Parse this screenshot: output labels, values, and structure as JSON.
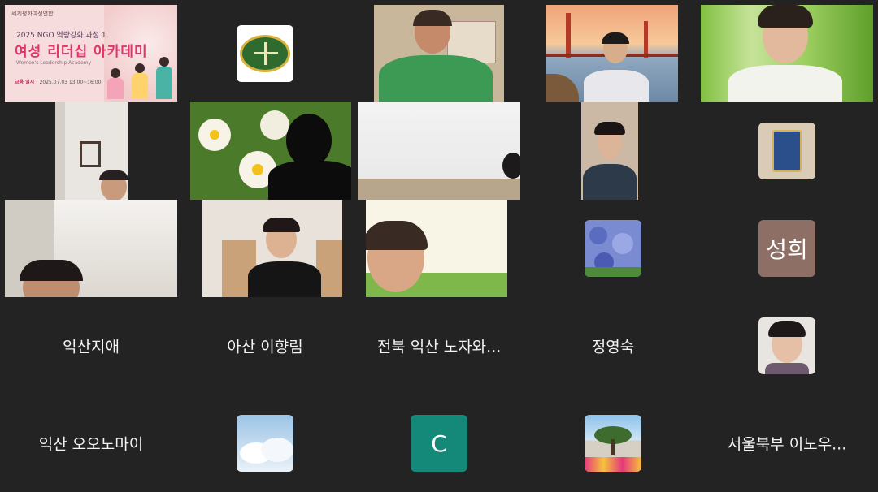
{
  "active_speaker_index": 0,
  "colors": {
    "background": "#232323",
    "active_outline": "#2ecc71",
    "name_text": "#f2f2f2"
  },
  "slide": {
    "header": "세계평화여성연합",
    "subtitle": "2025 NGO 역량강화 과정 1",
    "title": "여성 리더십 아카데미",
    "english": "Women's Leadership Academy",
    "date_label": "교육 일시 :",
    "date_value": "2025.07.03 13:00~16:00"
  },
  "participants": [
    {
      "id": "p1",
      "kind": "slide"
    },
    {
      "id": "p2",
      "kind": "avatar",
      "avatar": "logo-emblem"
    },
    {
      "id": "p3",
      "kind": "video",
      "scene": "person-green-shirt"
    },
    {
      "id": "p4",
      "kind": "video",
      "scene": "golden-gate-bridge"
    },
    {
      "id": "p5",
      "kind": "video",
      "scene": "person-grass"
    },
    {
      "id": "p6",
      "kind": "video",
      "scene": "room-corner-person"
    },
    {
      "id": "p7",
      "kind": "video",
      "scene": "daffodil-silhouette"
    },
    {
      "id": "p8",
      "kind": "video",
      "scene": "blank-wall"
    },
    {
      "id": "p9",
      "kind": "video",
      "scene": "person-glasses-hand"
    },
    {
      "id": "p10",
      "kind": "avatar",
      "avatar": "tea-tin"
    },
    {
      "id": "p11",
      "kind": "video",
      "scene": "person-low-angle"
    },
    {
      "id": "p12",
      "kind": "video",
      "scene": "person-room-glasses"
    },
    {
      "id": "p13",
      "kind": "video",
      "scene": "person-bright-room"
    },
    {
      "id": "p14",
      "kind": "avatar",
      "avatar": "hydrangea"
    },
    {
      "id": "p15",
      "kind": "avatar",
      "avatar": "initials",
      "initials": "성희",
      "color": "#8e6f66"
    },
    {
      "id": "p16",
      "kind": "name",
      "name": "익산지애"
    },
    {
      "id": "p17",
      "kind": "name",
      "name": "아산 이향림"
    },
    {
      "id": "p18",
      "kind": "name",
      "name": "전북 익산 노자와..."
    },
    {
      "id": "p19",
      "kind": "name",
      "name": "정영숙"
    },
    {
      "id": "p20",
      "kind": "avatar",
      "avatar": "portrait-photo"
    },
    {
      "id": "p21",
      "kind": "name",
      "name": "익산 오오노마이"
    },
    {
      "id": "p22",
      "kind": "avatar",
      "avatar": "clouds"
    },
    {
      "id": "p23",
      "kind": "avatar",
      "avatar": "initials",
      "initials": "C",
      "color": "#14897a"
    },
    {
      "id": "p24",
      "kind": "avatar",
      "avatar": "tree-flowers"
    },
    {
      "id": "p25",
      "kind": "name",
      "name": "서울북부 이노우..."
    }
  ]
}
